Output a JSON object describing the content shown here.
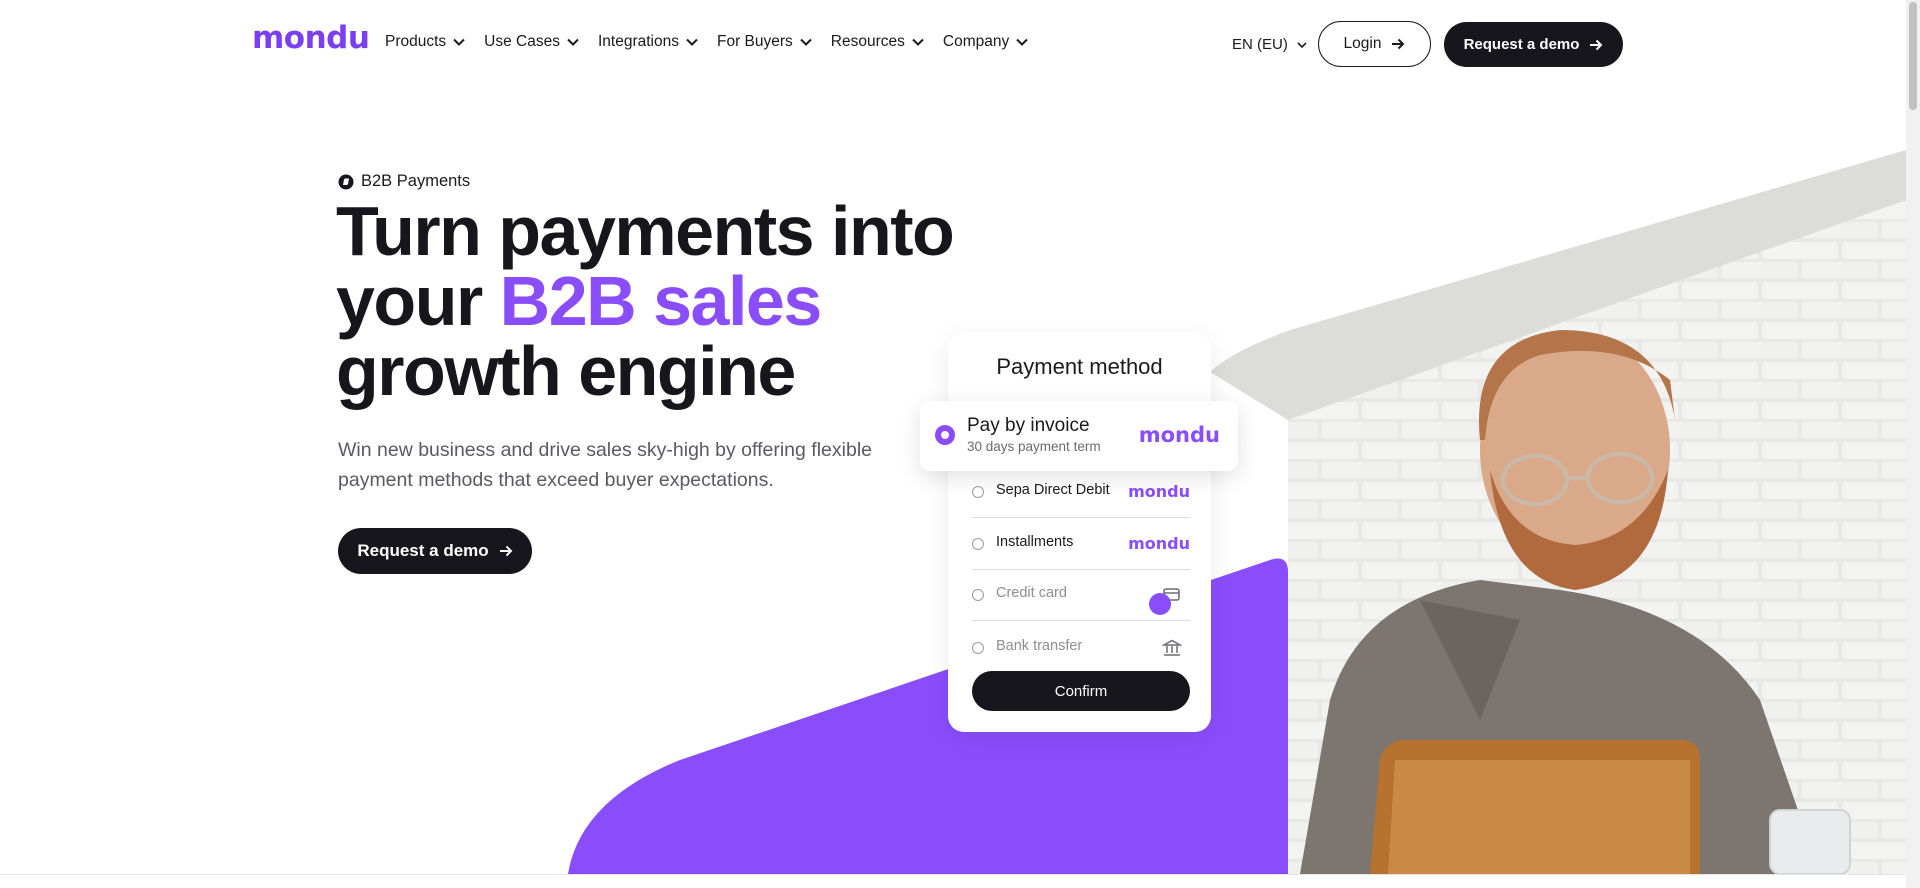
{
  "header": {
    "logo": "mondu",
    "nav": [
      {
        "label": "Products"
      },
      {
        "label": "Use Cases"
      },
      {
        "label": "Integrations"
      },
      {
        "label": "For Buyers"
      },
      {
        "label": "Resources"
      },
      {
        "label": "Company"
      }
    ],
    "language": "EN (EU)",
    "login_label": "Login",
    "demo_label": "Request a demo"
  },
  "hero": {
    "eyebrow": "B2B Payments",
    "headline_line1": "Turn payments into",
    "headline_line2_prefix": "your ",
    "headline_line2_accent": "B2B sales",
    "headline_line3": "growth engine",
    "subtext": "Win new business and drive sales sky-high by offering flexible payment methods that exceed buyer expectations.",
    "cta_label": "Request a demo"
  },
  "payment_card": {
    "title": "Payment method",
    "selected": {
      "title": "Pay by invoice",
      "subtitle": "30 days payment term",
      "brand": "mondu"
    },
    "options": [
      {
        "label": "Sepa Direct Debit",
        "brand": "mondu"
      },
      {
        "label": "Installments",
        "brand": "mondu"
      },
      {
        "label": "Credit card",
        "icon": "credit-card-icon"
      },
      {
        "label": "Bank transfer",
        "icon": "bank-icon"
      }
    ],
    "confirm_label": "Confirm"
  },
  "colors": {
    "brand_purple": "#8a4dfc",
    "dark": "#16161c"
  }
}
